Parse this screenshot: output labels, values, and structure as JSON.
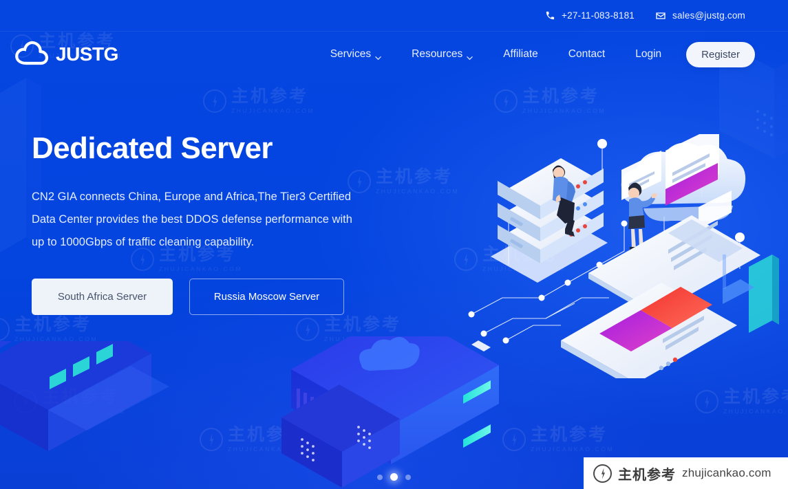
{
  "brand": {
    "name": "JUSTG",
    "logo_icon": "cloud-icon"
  },
  "topbar": {
    "phone_icon": "phone-icon",
    "phone": "+27-11-083-8181",
    "mail_icon": "envelope-icon",
    "email": "sales@justg.com"
  },
  "nav": {
    "items": [
      {
        "label": "Services",
        "has_dropdown": true,
        "icon": "chevron-down-icon"
      },
      {
        "label": "Resources",
        "has_dropdown": true,
        "icon": "chevron-down-icon"
      },
      {
        "label": "Affiliate",
        "has_dropdown": false,
        "icon": ""
      },
      {
        "label": "Contact",
        "has_dropdown": false,
        "icon": ""
      },
      {
        "label": "Login",
        "has_dropdown": false,
        "icon": ""
      }
    ],
    "register_label": "Register"
  },
  "hero": {
    "title": "Dedicated Server",
    "description": "CN2 GIA connects China, Europe and Africa,The Tier3 Certified Data Center provides the best DDOS defense performance with up to 1000Gbps of traffic cleaning capability.",
    "buttons": [
      {
        "label": "South Africa Server",
        "style": "primary"
      },
      {
        "label": "Russia Moscow Server",
        "style": "ghost"
      }
    ]
  },
  "carousel": {
    "slides": 3,
    "active_index": 1
  },
  "watermark": {
    "cn": "主机参考",
    "en": "ZHUJICANKAO.COM",
    "logo_icon": "lightning-circle-icon"
  },
  "badge": {
    "logo_icon": "lightning-circle-icon",
    "cn": "主机参考",
    "domain": "zhujicankao.com"
  },
  "colors": {
    "background": "#0545e0",
    "accent_cyan": "#2ee6d6",
    "magenta": "#c02ae0",
    "red": "#f2342f",
    "white": "#ffffff",
    "button_text": "#46536b"
  }
}
